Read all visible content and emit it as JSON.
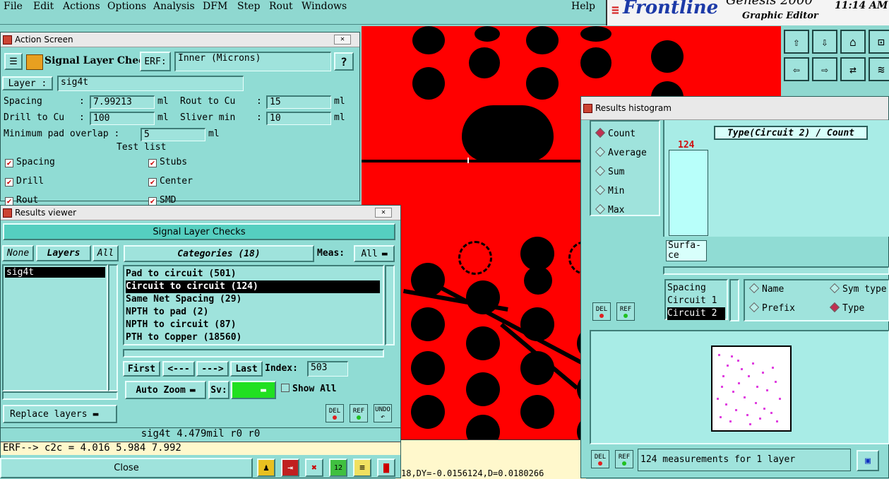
{
  "menubar": {
    "items": [
      "File",
      "Edit",
      "Actions",
      "Options",
      "Analysis",
      "DFM",
      "Step",
      "Rout",
      "Windows"
    ],
    "help": "Help",
    "brand": "Frontline",
    "product": "Genesis 2000",
    "subtitle": "Graphic Editor",
    "clock": "11:14 AM"
  },
  "action_screen": {
    "title": "Action Screen",
    "heading": "Signal Layer Checks",
    "erf_label": "ERF:",
    "erf_value": "Inner (Microns)",
    "help_label": "?",
    "layer_label": "Layer :",
    "layer_value": "sig4t",
    "params": {
      "spacing_label": "Spacing",
      "spacing_value": "7.99213",
      "rout_label": "Rout to Cu",
      "rout_value": "15",
      "drill_label": "Drill to Cu",
      "drill_value": "100",
      "sliver_label": "Sliver min",
      "sliver_value": "10",
      "pad_label": "Minimum pad overlap :",
      "pad_value": "5",
      "unit_ml": "ml",
      "unit_mil": "ml",
      "colon": ":"
    },
    "test_list": "Test list",
    "tests": [
      "Spacing",
      "Stubs",
      "Drill",
      "Center",
      "Rout",
      "SMD"
    ]
  },
  "results_viewer": {
    "title": "Results viewer",
    "banner": "Signal Layer Checks",
    "none_btn": "None",
    "layers_btn": "Layers",
    "all_btn": "All",
    "layers": [
      "sig4t"
    ],
    "categories_label": "Categories (18)",
    "meas_label": "Meas:",
    "meas_value": "All",
    "categories": [
      "Pad to circuit (501)",
      "Circuit to circuit (124)",
      "Same Net Spacing (29)",
      "NPTH to pad (2)",
      "NPTH to circuit (87)",
      "PTH to Copper (18560)"
    ],
    "nav": {
      "first": "First",
      "prev": "<---",
      "next": "--->",
      "last": "Last",
      "index_label": "Index:",
      "index_value": "503"
    },
    "auto_zoom": "Auto Zoom",
    "sv_label": "Sv:",
    "show_all": "Show All",
    "replace_layers": "Replace layers",
    "del": "DEL",
    "ref": "REF",
    "undo": "UNDO",
    "status": "sig4t 4.479mil  r0  r0",
    "erf_line": "ERF--> c2c = 4.016 5.984 7.992",
    "close": "Close"
  },
  "histogram": {
    "title": "Results histogram",
    "modes": [
      "Count",
      "Average",
      "Sum",
      "Min",
      "Max"
    ],
    "active_mode": "Count",
    "chart_title": "Type(Circuit 2) / Count",
    "bar_value": "124",
    "bar_label": "Surfa-ce",
    "fields": [
      "Spacing",
      "Circuit 1",
      "Circuit 2"
    ],
    "group_opts": [
      "Name",
      "Sym type",
      "Prefix",
      "Type"
    ],
    "active_group": "Type",
    "status": "124 measurements for 1 layer",
    "del": "DEL",
    "ref": "REF"
  },
  "coords": "18,DY=-0.0156124,D=0.0180266",
  "colors": {
    "panel": "#90dcd4",
    "button": "#9fe3dc",
    "copper": "#ff0000",
    "highlight": "#000000",
    "bar": "#b8fffa",
    "accent_green": "#21e021"
  }
}
